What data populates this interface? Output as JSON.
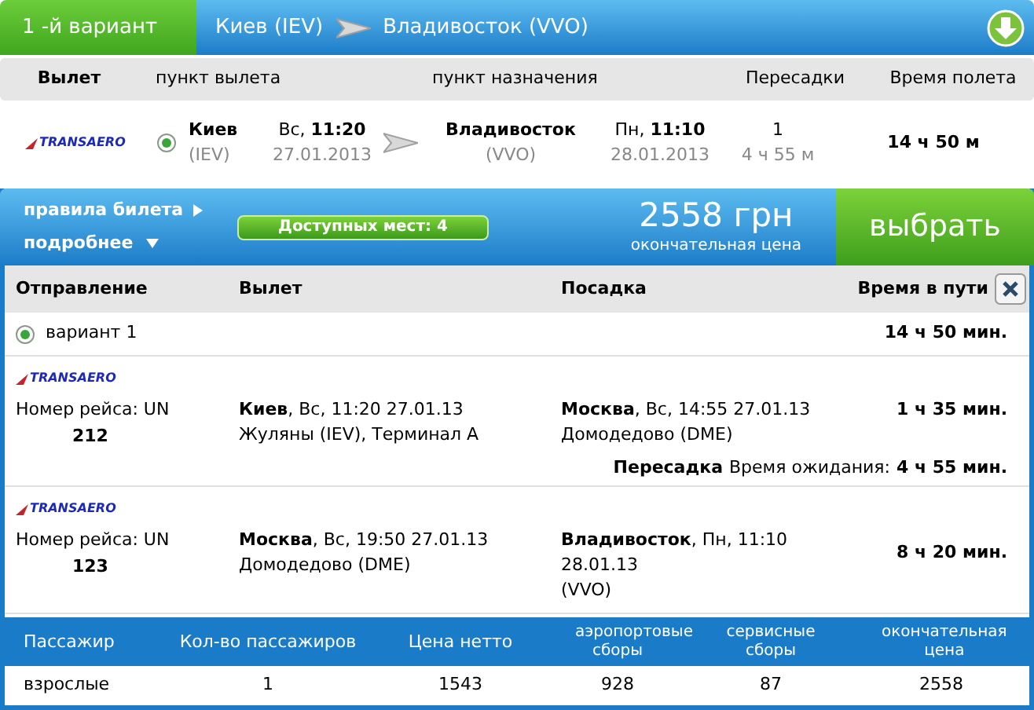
{
  "header": {
    "tab": "1 -й вариант",
    "from": "Киев (IEV)",
    "to": "Владивосток (VVO)"
  },
  "summary_columns": [
    "Вылет",
    "пункт вылета",
    "пункт назначения",
    "Пересадки",
    "Время полета"
  ],
  "summary": {
    "airline_logo": "TRANSAERO",
    "selected": true,
    "from_city": "Киев",
    "from_code": "(IEV)",
    "dep_day": "Вс,",
    "dep_time": "11:20",
    "dep_date": "27.01.2013",
    "to_city": "Владивосток",
    "to_code": "(VVO)",
    "arr_day": "Пн,",
    "arr_time": "11:10",
    "arr_date": "28.01.2013",
    "stops": "1",
    "stop_time": "4 ч 55 м",
    "duration": "14 ч 50 м"
  },
  "offer": {
    "rules_link": "правила билета",
    "more_link": "подробнее",
    "seats": "Доступных мест: 4",
    "price": "2558 грн",
    "price_note": "окончательная цена",
    "select_button": "выбрать"
  },
  "details": {
    "columns": [
      "Отправление",
      "Вылет",
      "Посадка",
      "Время в пути"
    ],
    "variant": {
      "label": "вариант 1",
      "selected": true,
      "duration": "14 ч 50 мин."
    },
    "segments": [
      {
        "kind": "flight",
        "airline_logo": "TRANSAERO",
        "flight_label": "Номер рейса: UN",
        "flight_number": "212",
        "departure": [
          "**Киев**, Вс, 11:20 27.01.13",
          "Жуляны (IEV), Терминал А"
        ],
        "arrival": [
          "**Москва**, Вс, 14:55 27.01.13",
          "Домодедово (DME)"
        ],
        "duration": "1 ч 35 мин."
      },
      {
        "kind": "transfer",
        "label": "Пересадка",
        "wait": "Время ожидания:",
        "duration": "4 ч 55 мин."
      },
      {
        "kind": "flight",
        "airline_logo": "TRANSAERO",
        "flight_label": "Номер рейса: UN",
        "flight_number": "123",
        "departure": [
          "**Москва**, Вс, 19:50 27.01.13",
          "Домодедово (DME)"
        ],
        "arrival": [
          "**Владивосток**, Пн, 11:10",
          "28.01.13",
          "(VVO)"
        ],
        "duration": "8 ч 20 мин."
      }
    ]
  },
  "passengers": {
    "columns": [
      "Пассажир",
      "Кол-во пассажиров",
      "Цена нетто",
      "аэропортовые сборы",
      "сервисные сборы",
      "окончательная цена"
    ],
    "rows": [
      [
        "взрослые",
        "1",
        "1543",
        "928",
        "87",
        "2558"
      ]
    ]
  }
}
